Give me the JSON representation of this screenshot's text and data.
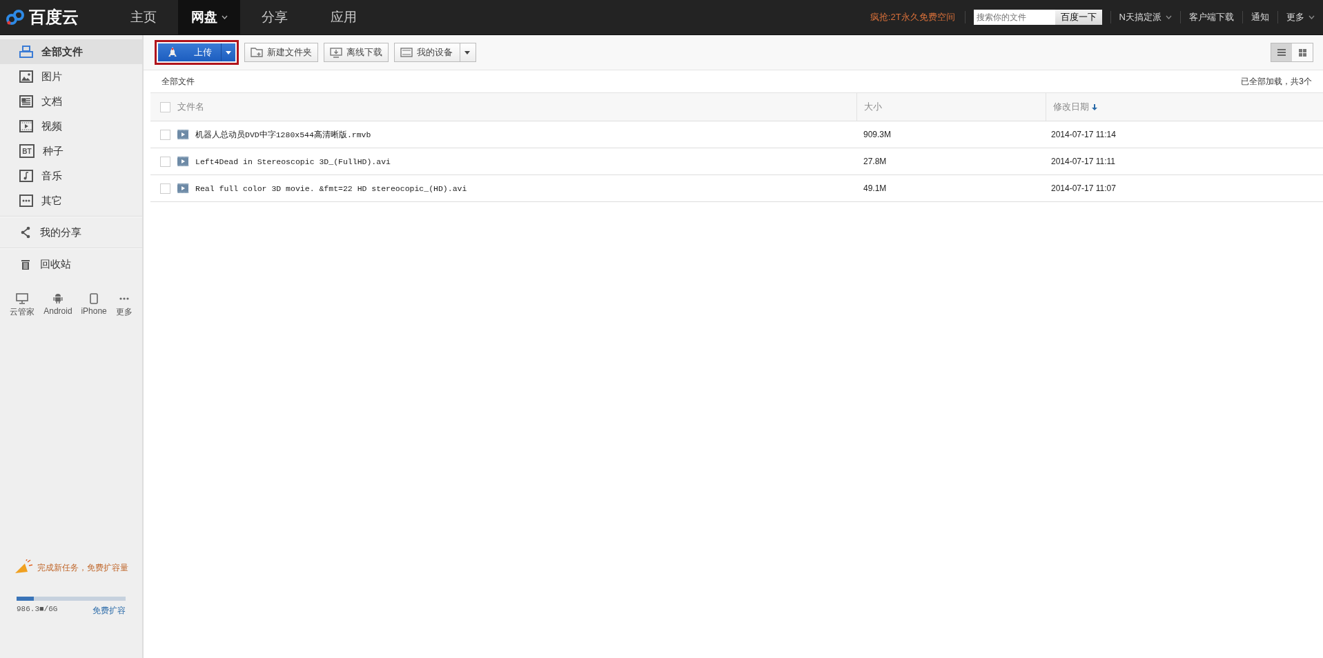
{
  "topbar": {
    "logo": "百度云",
    "nav": [
      {
        "label": "主页",
        "selected": false,
        "dropdown": false
      },
      {
        "label": "网盘",
        "selected": true,
        "dropdown": true
      },
      {
        "label": "分享",
        "selected": false,
        "dropdown": false
      },
      {
        "label": "应用",
        "selected": false,
        "dropdown": false
      }
    ],
    "promo": "疯抢:2T永久免费空间",
    "search": {
      "placeholder": "搜索你的文件",
      "button": "百度一下"
    },
    "links": [
      {
        "label": "N天搞定派",
        "dropdown": true
      },
      {
        "label": "客户端下载",
        "dropdown": false
      },
      {
        "label": "通知",
        "dropdown": false
      },
      {
        "label": "更多",
        "dropdown": true
      }
    ]
  },
  "sidebar": {
    "categories": [
      {
        "label": "全部文件",
        "selected": true
      },
      {
        "label": "图片",
        "selected": false
      },
      {
        "label": "文档",
        "selected": false
      },
      {
        "label": "视频",
        "selected": false
      },
      {
        "label": "种子",
        "selected": false,
        "icon_text": "BT"
      },
      {
        "label": "音乐",
        "selected": false
      },
      {
        "label": "其它",
        "selected": false
      }
    ],
    "share": {
      "label": "我的分享",
      "selected": false
    },
    "trash": {
      "label": "回收站",
      "selected": false
    },
    "devices": [
      {
        "label": "云管家"
      },
      {
        "label": "Android"
      },
      {
        "label": "iPhone"
      },
      {
        "label": "更多"
      }
    ],
    "task": "完成新任务，免费扩容量",
    "storage": {
      "level": 0.16,
      "used": "986.3■/6G",
      "link": "免费扩容"
    }
  },
  "toolbar": {
    "upload": {
      "label": "上传",
      "highlighted": true
    },
    "buttons": [
      {
        "label": "新建文件夹",
        "dropdown": false
      },
      {
        "label": "离线下载",
        "dropdown": false
      },
      {
        "label": "我的设备",
        "dropdown": true
      }
    ],
    "views": [
      {
        "kind": "list",
        "selected": true
      },
      {
        "kind": "grid",
        "selected": false
      }
    ]
  },
  "breadcrumb": "全部文件",
  "load_status": "已全部加载，共3个",
  "table": {
    "all_checked": false,
    "columns": [
      {
        "label": "文件名",
        "sorted": false
      },
      {
        "label": "大小",
        "sorted": false
      },
      {
        "label": "修改日期",
        "sorted": true
      }
    ],
    "rows": [
      {
        "name": "机器人总动员DVD中字1280x544高清晰版.rmvb",
        "size": "909.3M",
        "date": "2014-07-17 11:14",
        "checked": false
      },
      {
        "name": "Left4Dead in Stereoscopic 3D_(FullHD).avi",
        "size": "27.8M",
        "date": "2014-07-17 11:11",
        "checked": false
      },
      {
        "name": "Real full color 3D movie. &fmt=22 HD stereocopic_(HD).avi",
        "size": "49.1M",
        "date": "2014-07-17 11:07",
        "checked": false
      }
    ]
  }
}
